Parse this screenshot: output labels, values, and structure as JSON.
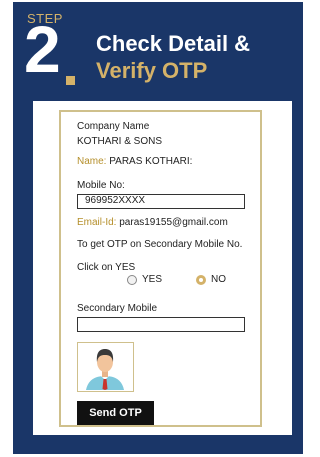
{
  "step": {
    "word": "STEP",
    "number": "2"
  },
  "headline": {
    "line1": "Check Detail &",
    "line2": "Verify OTP"
  },
  "form": {
    "company_label": "Company Name",
    "company_value": "KOTHARI & SONS",
    "name_label": "Name:",
    "name_value": "PARAS KOTHARI:",
    "mobile_label": "Mobile No:",
    "mobile_value": "969952XXXX",
    "email_label": "Email-Id:",
    "email_value": "paras19155@gmail.com",
    "otp_prompt": "To get OTP on Secondary Mobile No.",
    "click_prompt": "Click on YES",
    "yes_label": "YES",
    "no_label": "NO",
    "secondary_label": "Secondary Mobile",
    "secondary_value": "",
    "send_label": "Send OTP",
    "selected_option": "NO"
  },
  "colors": {
    "panel": "#1a3668",
    "accent": "#d4b269",
    "button": "#111111"
  },
  "icons": {
    "avatar": "user-avatar-icon"
  }
}
